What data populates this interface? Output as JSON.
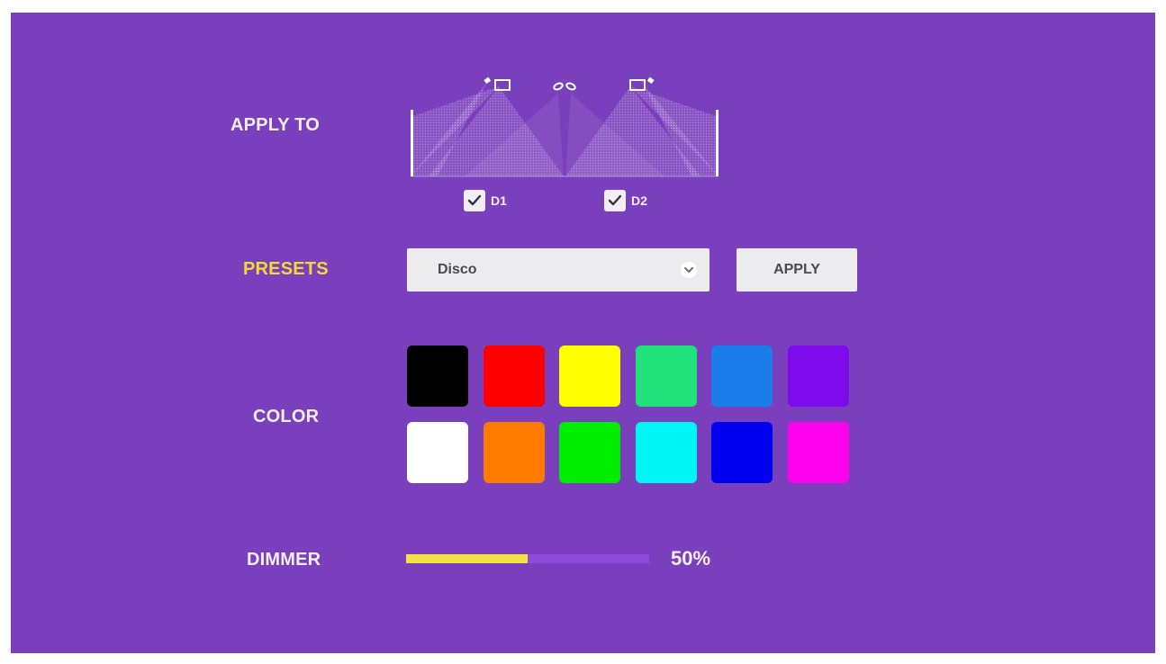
{
  "labels": {
    "apply_to": "APPLY TO",
    "presets": "PRESETS",
    "color": "COLOR",
    "dimmer": "DIMMER"
  },
  "apply_to": {
    "targets": [
      {
        "label": "D1",
        "checked": true
      },
      {
        "label": "D2",
        "checked": true
      }
    ]
  },
  "presets": {
    "selected": "Disco",
    "apply_label": "APPLY"
  },
  "color": {
    "swatches": [
      "#000000",
      "#ff0000",
      "#ffff00",
      "#21e27a",
      "#1a7de9",
      "#7d0bec",
      "#ffffff",
      "#ff7a00",
      "#00ee00",
      "#00f5f5",
      "#0000ee",
      "#ff00ee"
    ]
  },
  "dimmer": {
    "fraction": 0.5,
    "value_label": "50%"
  },
  "theme": {
    "background": "#7a3fbc",
    "active_label": "#f6d934",
    "dimmer_fill": "#f4e04a",
    "dimmer_track": "#8f4bdc"
  }
}
